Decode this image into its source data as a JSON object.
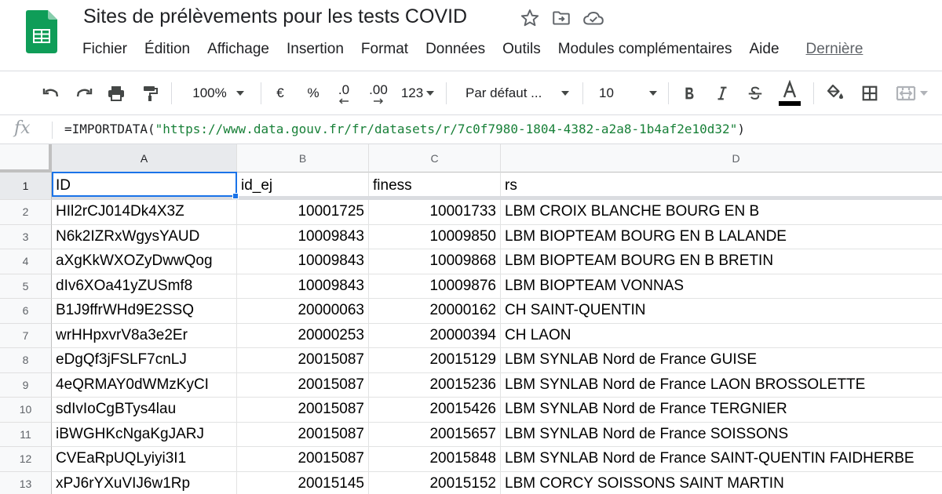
{
  "doc": {
    "title": "Sites de prélèvements pour les tests COVID"
  },
  "menu": [
    "Fichier",
    "Édition",
    "Affichage",
    "Insertion",
    "Format",
    "Données",
    "Outils",
    "Modules complémentaires",
    "Aide"
  ],
  "last_edit": "Dernière",
  "toolbar": {
    "zoom": "100%",
    "currency": "€",
    "percent": "%",
    "decrease_decimals": ".0",
    "increase_decimals": ".00",
    "more_formats": "123",
    "font": "Par défaut ...",
    "font_size": "10",
    "text_color": "#000000"
  },
  "formula_bar": {
    "fx": "fx",
    "prefix": "=IMPORTDATA(",
    "url": "\"https://www.data.gouv.fr/fr/datasets/r/7c0f7980-1804-4382-a2a8-1b4af2e10d32\"",
    "suffix": ")"
  },
  "columns": [
    "A",
    "B",
    "C",
    "D"
  ],
  "rows": [
    {
      "n": "1",
      "cells": [
        "ID",
        "id_ej",
        "finess",
        "rs"
      ]
    },
    {
      "n": "2",
      "cells": [
        "HIl2rCJ014Dk4X3Z",
        "10001725",
        "10001733",
        "LBM CROIX BLANCHE BOURG EN B"
      ]
    },
    {
      "n": "3",
      "cells": [
        "N6k2IZRxWgysYAUD",
        "10009843",
        "10009850",
        "LBM BIOPTEAM BOURG EN B LALANDE"
      ]
    },
    {
      "n": "4",
      "cells": [
        "aXgKkWXOZyDwwQog",
        "10009843",
        "10009868",
        "LBM BIOPTEAM BOURG EN B BRETIN"
      ]
    },
    {
      "n": "5",
      "cells": [
        "dIv6XOa41yZUSmf8",
        "10009843",
        "10009876",
        "LBM BIOPTEAM VONNAS"
      ]
    },
    {
      "n": "6",
      "cells": [
        "B1J9ffrWHd9E2SSQ",
        "20000063",
        "20000162",
        "CH SAINT-QUENTIN"
      ]
    },
    {
      "n": "7",
      "cells": [
        "wrHHpxvrV8a3e2Er",
        "20000253",
        "20000394",
        "CH LAON"
      ]
    },
    {
      "n": "8",
      "cells": [
        "eDgQf3jFSLF7cnLJ",
        "20015087",
        "20015129",
        "LBM SYNLAB Nord de France GUISE"
      ]
    },
    {
      "n": "9",
      "cells": [
        "4eQRMAY0dWMzKyCI",
        "20015087",
        "20015236",
        "LBM SYNLAB Nord de France LAON BROSSOLETTE"
      ]
    },
    {
      "n": "10",
      "cells": [
        "sdIvIoCgBTys4lau",
        "20015087",
        "20015426",
        "LBM SYNLAB Nord de France TERGNIER"
      ]
    },
    {
      "n": "11",
      "cells": [
        "iBWGHKcNgaKgJARJ",
        "20015087",
        "20015657",
        "LBM SYNLAB Nord de France SOISSONS"
      ]
    },
    {
      "n": "12",
      "cells": [
        "CVEaRpUQLyiyi3I1",
        "20015087",
        "20015848",
        "LBM SYNLAB Nord de France SAINT-QUENTIN FAIDHERBE"
      ]
    },
    {
      "n": "13",
      "cells": [
        "xPJ6rYXuVIJ6w1Rp",
        "20015145",
        "20015152",
        "LBM CORCY SOISSONS SAINT MARTIN"
      ]
    }
  ],
  "colors": {
    "accent": "#1a73e8",
    "sheets_green": "#0f9d58",
    "formula_string": "#188038"
  }
}
